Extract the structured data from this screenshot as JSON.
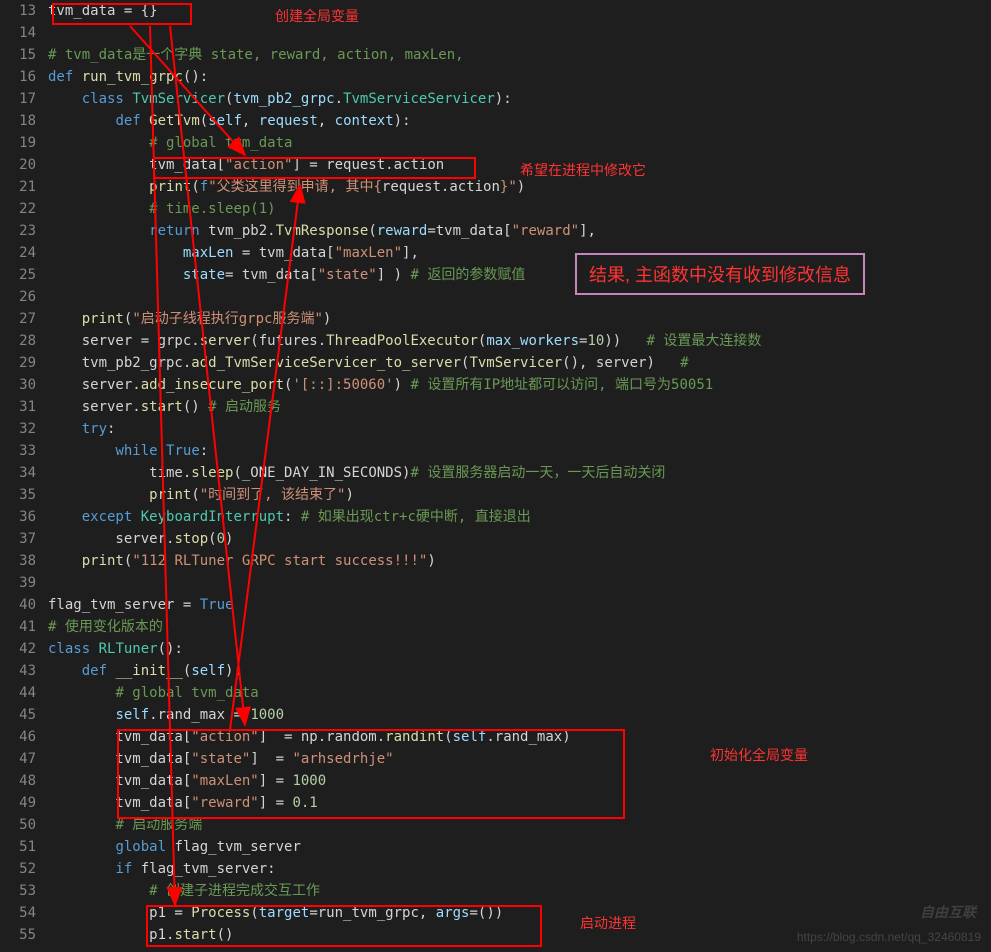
{
  "annotations": {
    "create_global": "创建全局变量",
    "modify_in_process": "希望在进程中修改它",
    "result": "结果, 主函数中没有收到修改信息",
    "init_global": "初始化全局变量",
    "start_process": "启动进程"
  },
  "watermark": "https://blog.csdn.net/qq_32460819",
  "logo": "自由互联",
  "lines": [
    {
      "n": 13,
      "html": "tvm_data = {}"
    },
    {
      "n": 14,
      "html": ""
    },
    {
      "n": 15,
      "html": "<span class='cmt'># tvm_data是一个字典 state, reward, action, maxLen,</span>"
    },
    {
      "n": 16,
      "html": "<span class='kw'>def</span> <span class='fn'>run_tvm_grpc</span>():"
    },
    {
      "n": 17,
      "html": "    <span class='kw'>class</span> <span class='cls'>TvmServicer</span>(<span class='param'>tvm_pb2_grpc</span>.<span class='cls'>TvmServiceServicer</span>):"
    },
    {
      "n": 18,
      "html": "        <span class='kw'>def</span> <span class='fn'>GetTvm</span>(<span class='self'>self</span>, <span class='param'>request</span>, <span class='param'>context</span>):"
    },
    {
      "n": 19,
      "html": "            <span class='cmt'># global tvm_data</span>"
    },
    {
      "n": 20,
      "html": "            tvm_data[<span class='str'>\"action\"</span>] = request.action"
    },
    {
      "n": 21,
      "html": "            <span class='fn'>print</span>(<span class='kw'>f</span><span class='str'>\"父类这里得到申请, 其中{</span>request.action<span class='str'>}\"</span>)"
    },
    {
      "n": 22,
      "html": "            <span class='cmt'># time.sleep(1)</span>"
    },
    {
      "n": 23,
      "html": "            <span class='kw'>return</span> tvm_pb2.<span class='fn'>TvmResponse</span>(<span class='param'>reward</span>=tvm_data[<span class='str'>\"reward\"</span>],"
    },
    {
      "n": 24,
      "html": "                <span class='param'>maxLen</span> = tvm_data[<span class='str'>\"maxLen\"</span>],"
    },
    {
      "n": 25,
      "html": "                <span class='param'>state</span>= tvm_data[<span class='str'>\"state\"</span>] ) <span class='cmt'># 返回的参数赋值</span>"
    },
    {
      "n": 26,
      "html": ""
    },
    {
      "n": 27,
      "html": "    <span class='fn'>print</span>(<span class='str'>\"启动子线程执行grpc服务端\"</span>)"
    },
    {
      "n": 28,
      "html": "    server = grpc.<span class='fn'>server</span>(futures.<span class='fn'>ThreadPoolExecutor</span>(<span class='param'>max_workers</span>=<span class='num'>10</span>))   <span class='cmt'># 设置最大连接数</span>"
    },
    {
      "n": 29,
      "html": "    tvm_pb2_grpc.<span class='fn'>add_TvmServiceServicer_to_server</span>(<span class='fn'>TvmServicer</span>(), server)   <span class='cmt'>#</span>"
    },
    {
      "n": 30,
      "html": "    server.<span class='fn'>add_insecure_port</span>(<span class='str'>'[::]:50060'</span>) <span class='cmt'># 设置所有IP地址都可以访问, 端口号为50051</span>"
    },
    {
      "n": 31,
      "html": "    server.<span class='fn'>start</span>() <span class='cmt'># 启动服务</span>"
    },
    {
      "n": 32,
      "html": "    <span class='kw'>try</span>:"
    },
    {
      "n": 33,
      "html": "        <span class='kw'>while</span> <span class='kw'>True</span>:"
    },
    {
      "n": 34,
      "html": "            time.<span class='fn'>sleep</span>(_ONE_DAY_IN_SECONDS)<span class='cmt'># 设置服务器启动一天，一天后自动关闭</span>"
    },
    {
      "n": 35,
      "html": "            <span class='fn'>print</span>(<span class='str'>\"时间到了, 该结束了\"</span>)"
    },
    {
      "n": 36,
      "html": "    <span class='kw'>except</span> <span class='cls'>KeyboardInterrupt</span>: <span class='cmt'># 如果出现ctr+c硬中断, 直接退出</span>"
    },
    {
      "n": 37,
      "html": "        server.<span class='fn'>stop</span>(<span class='num'>0</span>)"
    },
    {
      "n": 38,
      "html": "    <span class='fn'>print</span>(<span class='str'>\"112 RLTuner GRPC start success!!!\"</span>)"
    },
    {
      "n": 39,
      "html": ""
    },
    {
      "n": 40,
      "html": "flag_tvm_server = <span class='kw'>True</span>"
    },
    {
      "n": 41,
      "html": "<span class='cmt'># 使用变化版本的</span>"
    },
    {
      "n": 42,
      "html": "<span class='kw'>class</span> <span class='cls'>RLTuner</span>():"
    },
    {
      "n": 43,
      "html": "    <span class='kw'>def</span> <span class='fn'>__init__</span>(<span class='self'>self</span>):"
    },
    {
      "n": 44,
      "html": "        <span class='cmt'># global tvm_data</span>"
    },
    {
      "n": 45,
      "html": "        <span class='self'>self</span>.rand_max = <span class='num'>1000</span>"
    },
    {
      "n": 46,
      "html": "        tvm_data[<span class='str'>\"action\"</span>]  = np.random.<span class='fn'>randint</span>(<span class='self'>self</span>.rand_max)"
    },
    {
      "n": 47,
      "html": "        tvm_data[<span class='str'>\"state\"</span>]  = <span class='str'>\"arhsedrhje\"</span>"
    },
    {
      "n": 48,
      "html": "        tvm_data[<span class='str'>\"maxLen\"</span>] = <span class='num'>1000</span>"
    },
    {
      "n": 49,
      "html": "        tvm_data[<span class='str'>\"reward\"</span>] = <span class='num'>0.1</span>"
    },
    {
      "n": 50,
      "html": "        <span class='cmt'># 启动服务端</span>"
    },
    {
      "n": 51,
      "html": "        <span class='kw'>global</span> flag_tvm_server"
    },
    {
      "n": 52,
      "html": "        <span class='kw'>if</span> flag_tvm_server:"
    },
    {
      "n": 53,
      "html": "            <span class='cmt'># 创建子进程完成交互工作</span>"
    },
    {
      "n": 54,
      "html": "            p1 = <span class='fn'>Process</span>(<span class='param'>target</span>=run_tvm_grpc, <span class='param'>args</span>=())"
    },
    {
      "n": 55,
      "html": "            p1.<span class='fn'>start</span>()"
    }
  ]
}
